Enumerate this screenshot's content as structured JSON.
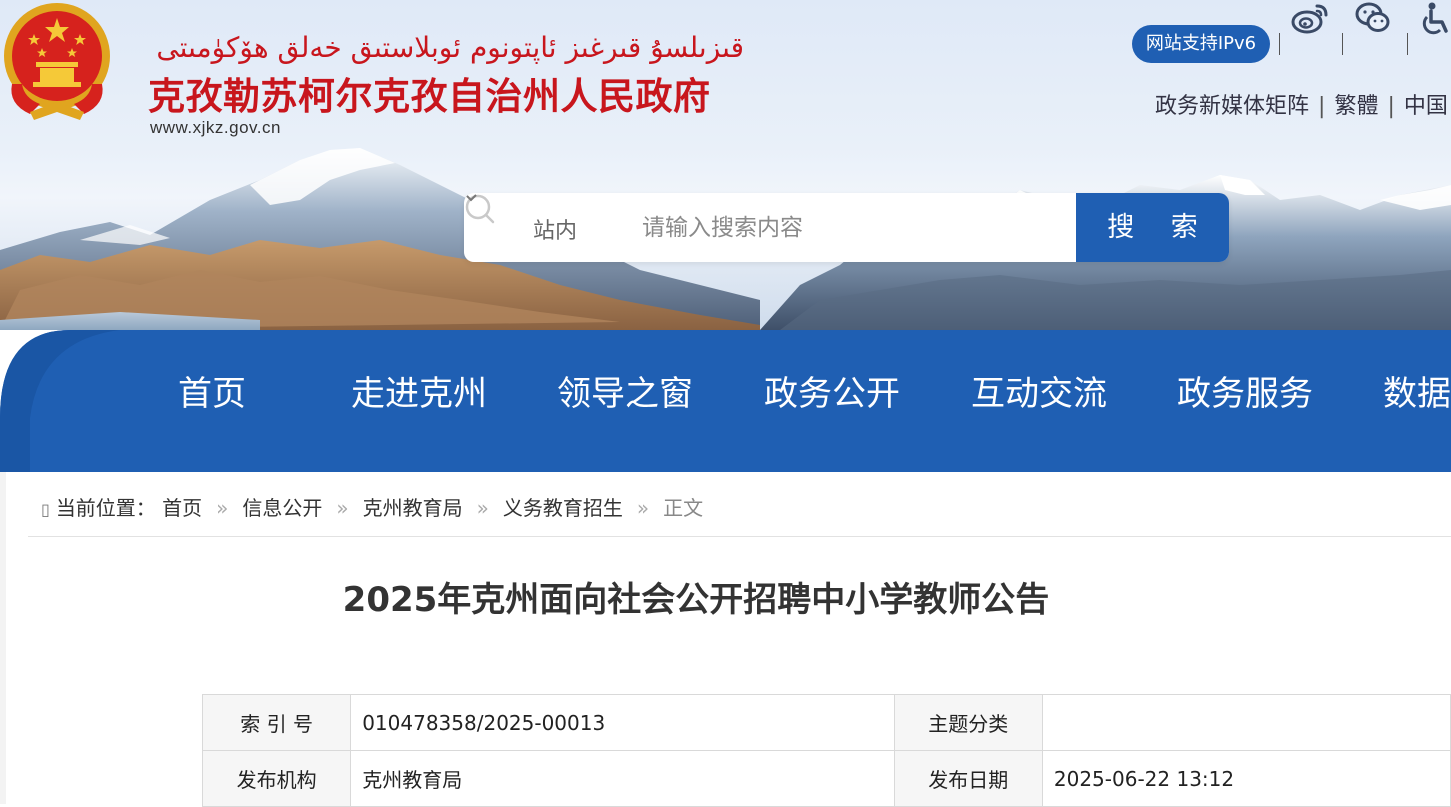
{
  "header": {
    "title_uyghur": "قىزىلسۇ قىرغىز ئاپتونوم ئوبلاستىق خەلق ھۆكۈمىتى",
    "title_chinese": "克孜勒苏柯尔克孜自治州人民政府",
    "site_url": "www.xjkz.gov.cn",
    "ipv6_badge": "网站支持IPv6",
    "icons": [
      "weibo-icon",
      "wechat-icon",
      "accessibility-icon"
    ],
    "links": [
      "政务新媒体矩阵",
      "繁體",
      "中国"
    ]
  },
  "search": {
    "scope_label": "站内",
    "placeholder": "请输入搜索内容",
    "button_label": "搜 索"
  },
  "nav": {
    "items": [
      "首页",
      "走进克州",
      "领导之窗",
      "政务公开",
      "互动交流",
      "政务服务",
      "数据"
    ]
  },
  "breadcrumb": {
    "prefix": "当前位置：",
    "items": [
      "首页",
      "信息公开",
      "克州教育局",
      "义务教育招生"
    ],
    "current": "正文"
  },
  "article": {
    "title": "2025年克州面向社会公开招聘中小学教师公告"
  },
  "meta": {
    "rows": [
      {
        "k1": "索 引 号",
        "v1": "010478358/2025-00013",
        "k2": "主题分类",
        "v2": ""
      },
      {
        "k1": "发布机构",
        "v1": "克州教育局",
        "k2": "发布日期",
        "v2": "2025-06-22 13:12"
      }
    ]
  },
  "colors": {
    "brand_red": "#c8161d",
    "nav_blue": "#1f5fb3"
  }
}
